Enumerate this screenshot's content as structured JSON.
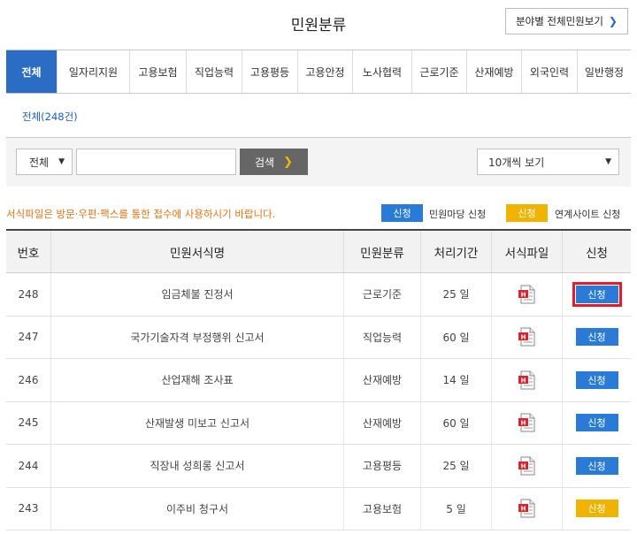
{
  "header": {
    "title": "민원분류",
    "all_button_label": "분야별 전체민원보기",
    "all_button_icon": "chevron-right-icon"
  },
  "tabs": [
    "전체",
    "일자리지원",
    "고용보험",
    "직업능력",
    "고용평등",
    "고용안정",
    "노사협력",
    "근로기준",
    "산재예방",
    "외국인력",
    "일반행정"
  ],
  "active_tab": "전체",
  "count_label": "전체(248건)",
  "search": {
    "field_select": "전체",
    "query_value": "",
    "button_label": "검색",
    "page_size_select": "10개씩 보기"
  },
  "notice": "서식파일은 방문·우편·팩스를 통한 접수에 사용하시기 바랍니다.",
  "legend": [
    {
      "badge": "신청",
      "text": "민원마당 신청",
      "color": "#2a7bd8"
    },
    {
      "badge": "신청",
      "text": "연계사이트 신청",
      "color": "#f0b400"
    }
  ],
  "table": {
    "headers": [
      "번호",
      "민원서식명",
      "민원분류",
      "처리기간",
      "서식파일",
      "신청"
    ],
    "rows": [
      {
        "no": "248",
        "name": "임금체불 진정서",
        "category": "근로기준",
        "period": "25 일",
        "file_icon": "hwp-file-icon",
        "apply": "신청",
        "apply_color": "#2a7bd8",
        "highlighted": true
      },
      {
        "no": "247",
        "name": "국가기술자격 부정행위 신고서",
        "category": "직업능력",
        "period": "60 일",
        "file_icon": "hwp-file-icon",
        "apply": "신청",
        "apply_color": "#2a7bd8",
        "highlighted": false
      },
      {
        "no": "246",
        "name": "산업재해 조사표",
        "category": "산재예방",
        "period": "14 일",
        "file_icon": "hwp-file-icon",
        "apply": "신청",
        "apply_color": "#2a7bd8",
        "highlighted": false
      },
      {
        "no": "245",
        "name": "산재발생 미보고 신고서",
        "category": "산재예방",
        "period": "60 일",
        "file_icon": "hwp-file-icon",
        "apply": "신청",
        "apply_color": "#2a7bd8",
        "highlighted": false
      },
      {
        "no": "244",
        "name": "직장내 성희롱 신고서",
        "category": "고용평등",
        "period": "25 일",
        "file_icon": "hwp-file-icon",
        "apply": "신청",
        "apply_color": "#2a7bd8",
        "highlighted": false
      },
      {
        "no": "243",
        "name": "이주비 청구서",
        "category": "고용보험",
        "period": "5 일",
        "file_icon": "hwp-file-icon",
        "apply": "신청",
        "apply_color": "#f0b400",
        "highlighted": false
      }
    ]
  }
}
